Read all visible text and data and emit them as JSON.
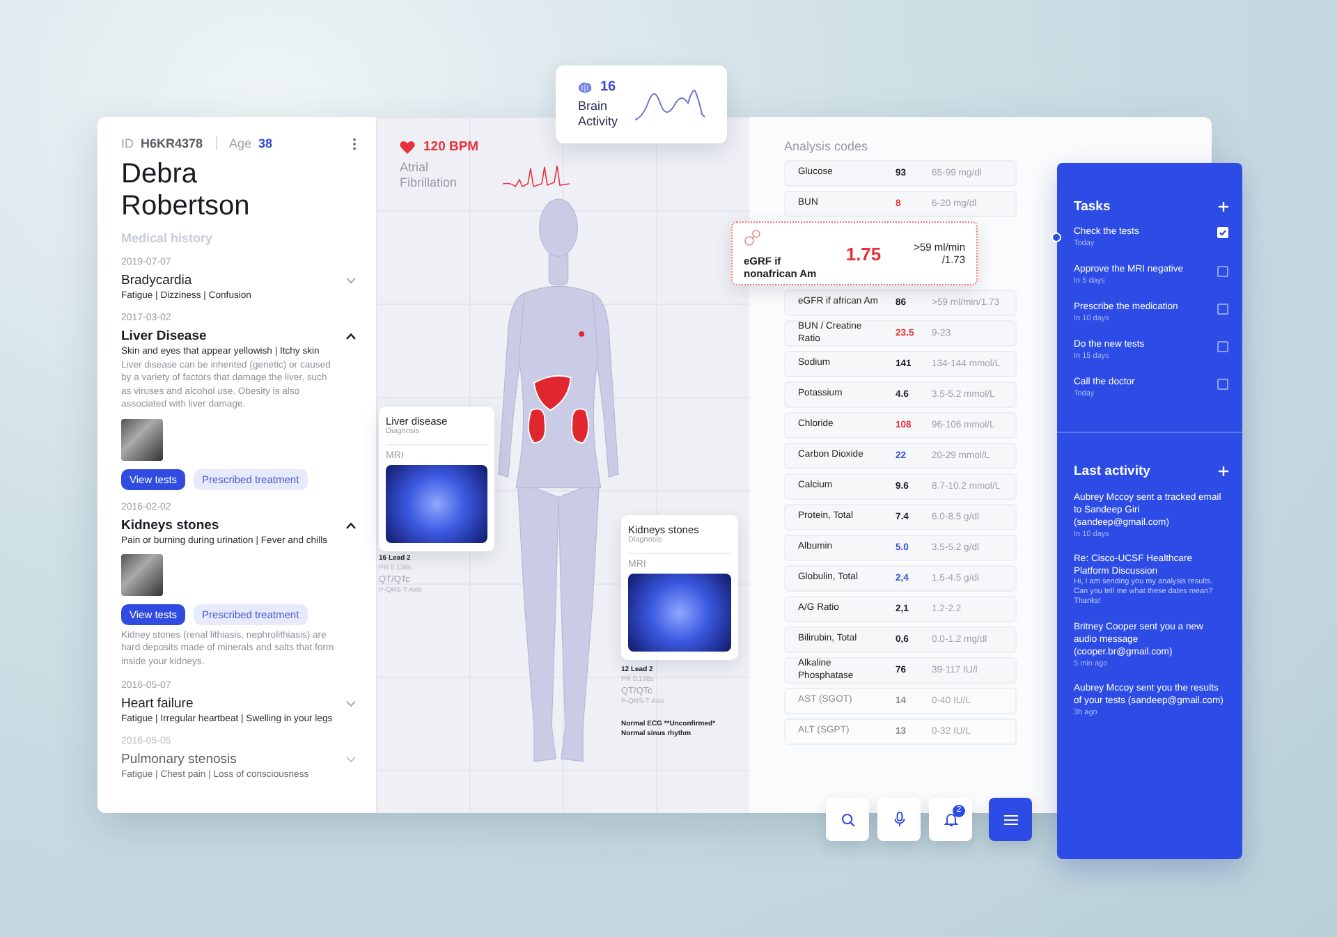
{
  "patient": {
    "id_label": "ID",
    "id": "H6KR4378",
    "age_label": "Age",
    "age": "38",
    "name": "Debra Robertson",
    "history_title": "Medical history",
    "history": [
      {
        "date": "2019-07-07",
        "title": "Bradycardia",
        "symptoms": "Fatigue | Dizziness | Confusion",
        "expanded": false,
        "faded": false
      },
      {
        "date": "2017-03-02",
        "title": "Liver Disease",
        "symptoms": "Skin and eyes that appear yellowish | Itchy skin",
        "expanded": true,
        "faded": false,
        "details": [
          {
            "kind": "text",
            "text": "Liver disease can be inherited (genetic) or caused by a variety of factors that damage the liver, such as viruses and alcohol use. Obesity is also associated with liver damage."
          },
          {
            "kind": "scan"
          },
          {
            "kind": "actions",
            "primary": "View tests",
            "secondary": "Prescribed treatment"
          }
        ]
      },
      {
        "date": "2016-02-02",
        "title": "Kidneys stones",
        "symptoms": "Pain or burning during urination | Fever and chills",
        "expanded": true,
        "faded": false,
        "details": [
          {
            "kind": "scan"
          },
          {
            "kind": "actions",
            "primary": "View tests",
            "secondary": "Prescribed treatment"
          },
          {
            "kind": "text",
            "text": "Kidney stones (renal lithiasis, nephrolithiasis) are hard deposits made of minerals and salts that form inside your kidneys."
          }
        ]
      },
      {
        "date": "2016-05-07",
        "title": "Heart failure",
        "symptoms": "Fatigue | Irregular heartbeat | Swelling in your legs",
        "expanded": false,
        "faded": false
      },
      {
        "date": "2016-05-05",
        "title": "Pulmonary stenosis",
        "symptoms": "Fatigue | Chest pain | Loss of consciousness",
        "expanded": false,
        "faded": true
      }
    ]
  },
  "vitals": {
    "bpm": "120 BPM",
    "rhythm": "Atrial Fibrillation"
  },
  "brain": {
    "value": "16",
    "label": "Brain Activity"
  },
  "diagnoses": [
    {
      "title": "Liver disease",
      "subtitle": "Diagnosis",
      "scan_label": "MRI",
      "notes": [
        {
          "kind": "strong",
          "text": "16 Lead 2"
        },
        {
          "kind": "muted",
          "text": "PR 0.138s"
        },
        {
          "kind": "label",
          "text": "QT/QTc"
        },
        {
          "kind": "muted",
          "text": "P-QRS-T Axis"
        }
      ]
    },
    {
      "title": "Kidneys stones",
      "subtitle": "Diagnosis",
      "scan_label": "MRI",
      "notes": [
        {
          "kind": "strong",
          "text": "12 Lead 2"
        },
        {
          "kind": "muted",
          "text": "PR 0.138s"
        },
        {
          "kind": "label",
          "text": "QT/QTc"
        },
        {
          "kind": "muted",
          "text": "P-QRS-T Axis"
        },
        {
          "kind": "gap",
          "text": "Normal ECG **Unconfirmed*"
        },
        {
          "kind": "strong",
          "text": "Normal sinus rhythm"
        }
      ]
    }
  ],
  "analysis": {
    "title": "Analysis codes",
    "popup": {
      "label": "eGRF if nonafrican Am",
      "value": "1.75",
      "range": ">59 ml/min /1.73"
    },
    "rows": [
      {
        "name": "Glucose",
        "value": "93",
        "range": "65-99 mg/dl",
        "color": "#1b1b22",
        "faded": false
      },
      {
        "name": "BUN",
        "value": "8",
        "range": "6-20 mg/dl",
        "color": "#e5323b",
        "faded": false
      },
      {
        "kind": "popup"
      },
      {
        "name": "eGFR if african Am",
        "value": "86",
        "range": ">59 ml/min/1.73",
        "color": "#1b1b22",
        "faded": false
      },
      {
        "name": "BUN / Creatine Ratio",
        "value": "23.5",
        "range": "9-23",
        "color": "#e5323b",
        "faded": false
      },
      {
        "name": "Sodium",
        "value": "141",
        "range": "134-144 mmol/L",
        "color": "#1b1b22",
        "faded": false
      },
      {
        "name": "Potassium",
        "value": "4.6",
        "range": "3.5-5.2 mmol/L",
        "color": "#1b1b22",
        "faded": false
      },
      {
        "name": "Chloride",
        "value": "108",
        "range": "96-106 mmol/L",
        "color": "#e5323b",
        "faded": false
      },
      {
        "name": "Carbon Dioxide",
        "value": "22",
        "range": "20-29 mmol/L",
        "color": "#3b4fd8",
        "faded": false
      },
      {
        "name": "Calcium",
        "value": "9.6",
        "range": "8.7-10.2 mmol/L",
        "color": "#1b1b22",
        "faded": false
      },
      {
        "name": "Protein, Total",
        "value": "7.4",
        "range": "6.0-8.5 g/dl",
        "color": "#1b1b22",
        "faded": false
      },
      {
        "name": "Albumin",
        "value": "5.0",
        "range": "3.5-5.2 g/dl",
        "color": "#3b4fd8",
        "faded": false
      },
      {
        "name": "Globulin, Total",
        "value": "2,4",
        "range": "1.5-4.5 g/dl",
        "color": "#3b4fd8",
        "faded": false
      },
      {
        "name": "A/G Ratio",
        "value": "2,1",
        "range": "1.2-2.2",
        "color": "#1b1b22",
        "faded": false
      },
      {
        "name": "Bilirubin, Total",
        "value": "0,6",
        "range": "0.0-1.2 mg/dl",
        "color": "#1b1b22",
        "faded": false
      },
      {
        "name": "Alkaline Phosphatase",
        "value": "76",
        "range": "39-117 IU/l",
        "color": "#1b1b22",
        "faded": false
      },
      {
        "name": "AST (SGOT)",
        "value": "14",
        "range": "0-40 IU/L",
        "color": "#8c8d98",
        "faded": true
      },
      {
        "name": "ALT (SGPT)",
        "value": "13",
        "range": "0-32 IU/L",
        "color": "#8c8d98",
        "faded": true
      }
    ]
  },
  "tasks": {
    "title": "Tasks",
    "items": [
      {
        "title": "Check the tests",
        "due": "Today",
        "checked": true
      },
      {
        "title": "Approve the MRI negative",
        "due": "In 5 days",
        "checked": false
      },
      {
        "title": "Prescribe the medication",
        "due": "In 10 days",
        "checked": false
      },
      {
        "title": "Do the new tests",
        "due": "In 15 days",
        "checked": false
      },
      {
        "title": "Call the doctor",
        "due": "Today",
        "checked": false
      }
    ]
  },
  "activity": {
    "title": "Last activity",
    "items": [
      {
        "title": "Aubrey Mccoy sent a tracked email to Sandeep Giri (sandeep@gmail.com)",
        "time": "In 10 days"
      },
      {
        "title": "Re: Cisco-UCSF Healthcare Platform Discussion",
        "message": "Hi, I am sending you my analysis results. Can you tell me what these dates mean? Thanks!"
      },
      {
        "title": "Britney Cooper sent you a new audio message (cooper.br@gmail.com)",
        "time": "5 min ago"
      },
      {
        "title": "Aubrey Mccoy sent you the results of your tests (sandeep@gmail.com)",
        "time": "3h ago"
      }
    ]
  },
  "toolbar": {
    "notifications": "2"
  }
}
